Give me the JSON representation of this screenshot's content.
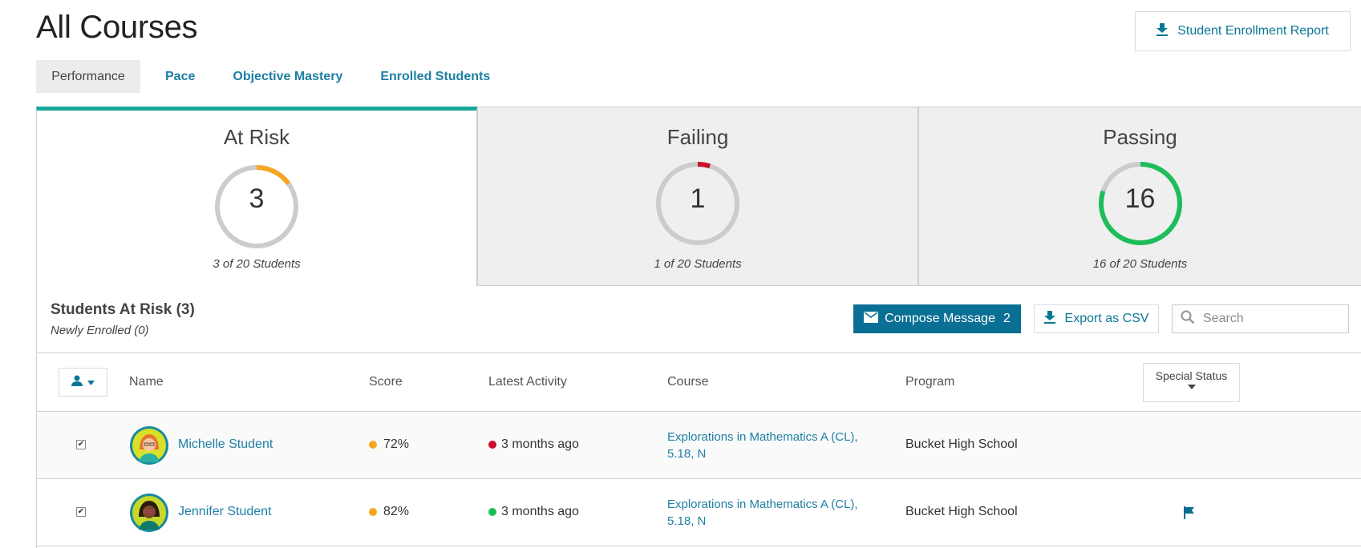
{
  "header": {
    "title": "All Courses",
    "report_button": "Student Enrollment Report"
  },
  "tabs": [
    {
      "label": "Performance",
      "active": true
    },
    {
      "label": "Pace",
      "active": false
    },
    {
      "label": "Objective Mastery",
      "active": false
    },
    {
      "label": "Enrolled Students",
      "active": false
    }
  ],
  "cards": [
    {
      "title": "At Risk",
      "count": "3",
      "subtitle": "3 of 20 Students",
      "fraction": 0.15,
      "color": "#f5a623",
      "active": true
    },
    {
      "title": "Failing",
      "count": "1",
      "subtitle": "1 of 20 Students",
      "fraction": 0.05,
      "color": "#c8102e",
      "active": false
    },
    {
      "title": "Passing",
      "count": "16",
      "subtitle": "16 of 20 Students",
      "fraction": 0.8,
      "color": "#1dbd5a",
      "active": false
    }
  ],
  "section": {
    "title": "Students At Risk (3)",
    "subtitle": "Newly Enrolled (0)",
    "compose_label": "Compose Message",
    "compose_count": "2",
    "export_label": "Export as CSV",
    "search_placeholder": "Search"
  },
  "table": {
    "columns": {
      "name": "Name",
      "score": "Score",
      "activity": "Latest Activity",
      "course": "Course",
      "program": "Program",
      "special": "Special Status"
    },
    "rows": [
      {
        "checked": true,
        "name": "Michelle Student",
        "score": "72%",
        "score_color": "#f5a623",
        "activity": "3 months ago",
        "activity_color": "#c8102e",
        "course_line1": "Explorations in Mathematics A (CL),",
        "course_line2": "5.18, N",
        "program": "Bucket High School",
        "flagged": false
      },
      {
        "checked": true,
        "name": "Jennifer Student",
        "score": "82%",
        "score_color": "#f5a623",
        "activity": "3 months ago",
        "activity_color": "#1dbd5a",
        "course_line1": "Explorations in Mathematics A (CL),",
        "course_line2": "5.18, N",
        "program": "Bucket High School",
        "flagged": true
      }
    ]
  },
  "colors": {
    "accent": "#0a6f94",
    "link": "#1e7fa3",
    "active_tab_bar": "#16a79a",
    "ring_track": "#cccccc"
  }
}
